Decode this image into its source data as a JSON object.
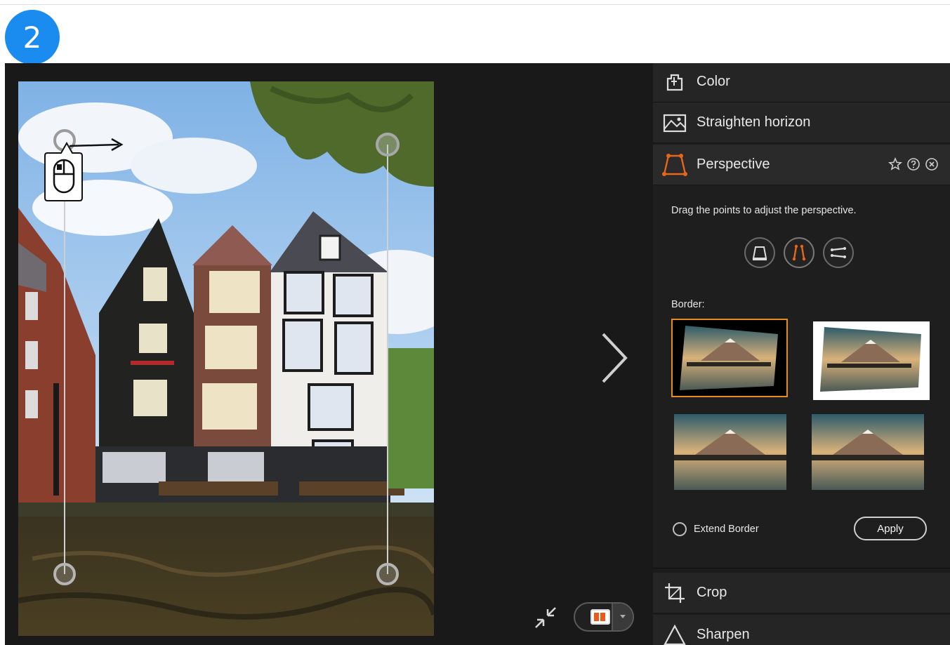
{
  "step_badge": "2",
  "panel": {
    "tools": [
      {
        "label": "Color",
        "icon": "color-icon"
      },
      {
        "label": "Straighten horizon",
        "icon": "straighten-horizon-icon"
      },
      {
        "label": "Perspective",
        "icon": "perspective-icon",
        "active": true
      },
      {
        "label": "Crop",
        "icon": "crop-icon"
      },
      {
        "label": "Sharpen",
        "icon": "sharpen-icon"
      }
    ],
    "perspective": {
      "hint": "Drag the points to adjust the perspective.",
      "modes": [
        "trapezoid-mode-icon",
        "vertical-lines-mode-icon",
        "horizontal-lines-mode-icon"
      ],
      "selected_mode": 1,
      "border_label": "Border:",
      "border_options": [
        "black-border",
        "white-border",
        "crop-border",
        "stretch-border"
      ],
      "selected_border": 0,
      "extend_border_label": "Extend Border",
      "apply_label": "Apply"
    }
  },
  "colors": {
    "accent": "#e8651a",
    "selection": "#e78a1f",
    "badge": "#1a8cf0"
  }
}
